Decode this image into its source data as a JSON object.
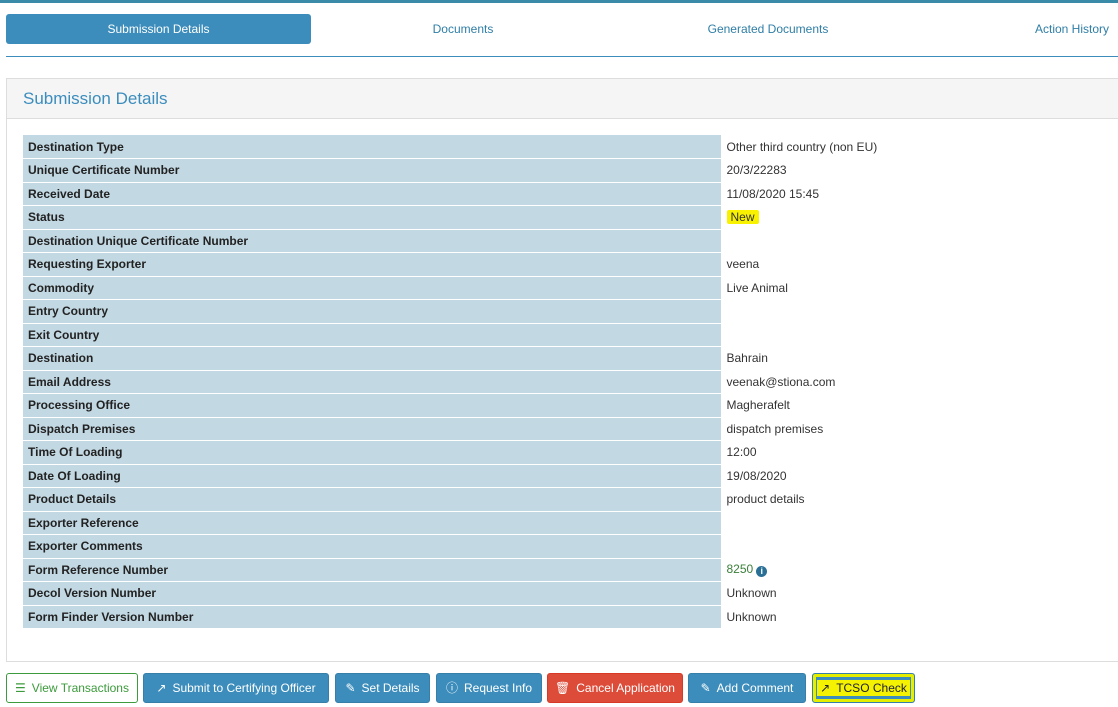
{
  "tabs": [
    {
      "label": "Submission Details"
    },
    {
      "label": "Documents"
    },
    {
      "label": "Generated Documents"
    },
    {
      "label": "Action History"
    }
  ],
  "panel": {
    "title": "Submission Details"
  },
  "details": [
    {
      "label": "Destination Type",
      "value": "Other third country (non EU)"
    },
    {
      "label": "Unique Certificate Number",
      "value": "20/3/22283"
    },
    {
      "label": "Received Date",
      "value": "11/08/2020 15:45"
    },
    {
      "label": "Status",
      "value": "New"
    },
    {
      "label": "Destination Unique Certificate Number",
      "value": ""
    },
    {
      "label": "Requesting Exporter",
      "value": "veena"
    },
    {
      "label": "Commodity",
      "value": "Live Animal"
    },
    {
      "label": "Entry Country",
      "value": ""
    },
    {
      "label": "Exit Country",
      "value": ""
    },
    {
      "label": "Destination",
      "value": "Bahrain"
    },
    {
      "label": "Email Address",
      "value": "veenak@stiona.com"
    },
    {
      "label": "Processing Office",
      "value": "Magherafelt"
    },
    {
      "label": "Dispatch Premises",
      "value": "dispatch premises"
    },
    {
      "label": "Time Of Loading",
      "value": "12:00"
    },
    {
      "label": "Date Of Loading",
      "value": "19/08/2020"
    },
    {
      "label": "Product Details",
      "value": "product details"
    },
    {
      "label": "Exporter Reference",
      "value": ""
    },
    {
      "label": "Exporter Comments",
      "value": ""
    },
    {
      "label": "Form Reference Number",
      "value": "8250"
    },
    {
      "label": "Decol Version Number",
      "value": "Unknown"
    },
    {
      "label": "Form Finder Version Number",
      "value": "Unknown"
    }
  ],
  "actions": {
    "view_transactions": "View Transactions",
    "submit_to_certifying_officer": "Submit to Certifying Officer",
    "set_details": "Set Details",
    "request_info": "Request Info",
    "cancel_application": "Cancel Application",
    "add_comment": "Add Comment",
    "tcso_check": "TCSO Check"
  },
  "colors": {
    "primary": "#3c8dbc",
    "label_bg": "#c2d8e3",
    "danger": "#dd4b39",
    "success_outline": "#3c9b3c",
    "highlight": "#f8f200"
  },
  "icons": {
    "view_transactions": "list-icon",
    "submit": "share-square-icon",
    "set_details": "edit-icon",
    "request_info": "info-circle-icon",
    "cancel": "trash-icon",
    "add_comment": "edit-icon",
    "tcso": "share-square-icon",
    "form_reference_info": "info-circle-icon"
  }
}
